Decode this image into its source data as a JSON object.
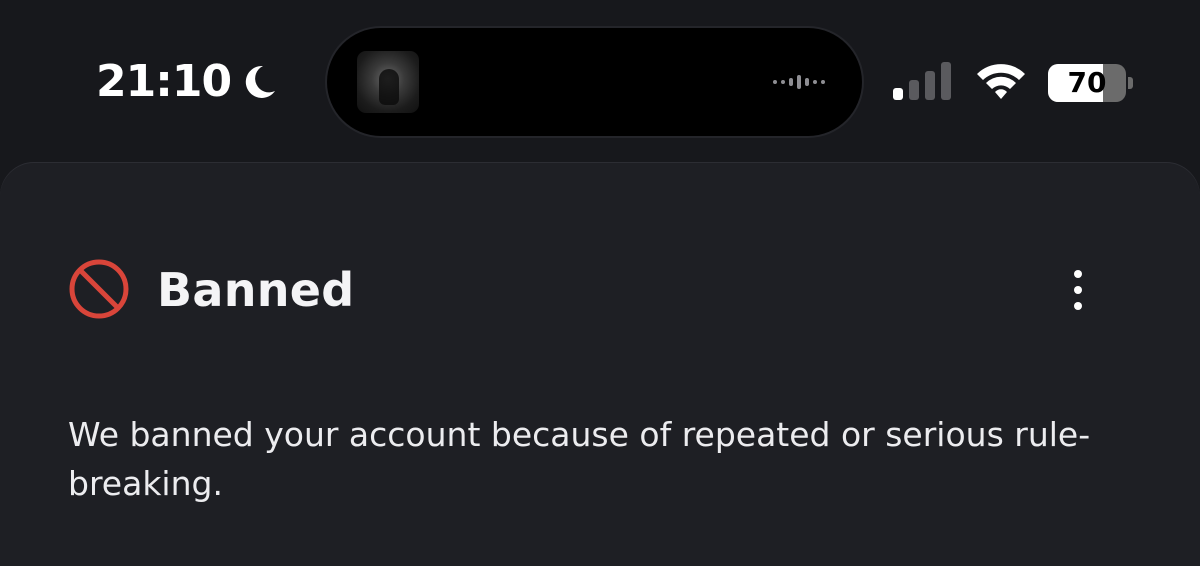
{
  "status_bar": {
    "time": "21:10",
    "focus_icon": "moon-icon",
    "now_playing": {
      "album_art": "album-art",
      "activity_icon": "waveform-icon"
    },
    "signal": {
      "icon": "cellular-signal-icon",
      "bars_active": 1,
      "bars_total": 4
    },
    "wifi_icon": "wifi-icon",
    "battery": {
      "level": "70",
      "fraction": 0.7
    }
  },
  "sheet": {
    "status_icon": "prohibited-icon",
    "status_icon_color": "#d9453a",
    "title": "Banned",
    "menu_icon": "more-vertical-icon",
    "message": "We banned your account because of repeated or serious rule-breaking."
  },
  "colors": {
    "background": "#17181c",
    "sheet": "#1e1f24",
    "text": "#f4f4f6",
    "danger": "#d9453a"
  }
}
